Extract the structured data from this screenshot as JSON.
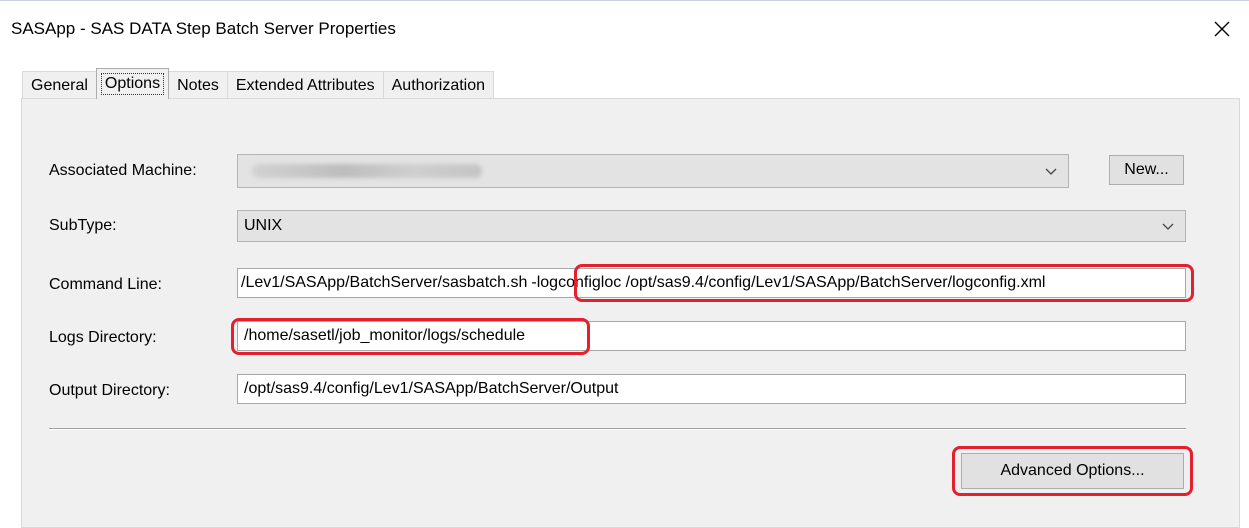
{
  "window": {
    "title": "SASApp - SAS DATA Step Batch Server Properties"
  },
  "tabs": [
    {
      "label": "General",
      "active": false
    },
    {
      "label": "Options",
      "active": true
    },
    {
      "label": "Notes",
      "active": false
    },
    {
      "label": "Extended Attributes",
      "active": false
    },
    {
      "label": "Authorization",
      "active": false
    }
  ],
  "form": {
    "associated_machine": {
      "label": "Associated Machine:",
      "value": ""
    },
    "new_button": "New...",
    "subtype": {
      "label": "SubType:",
      "value": "UNIX"
    },
    "command_line": {
      "label": "Command Line:",
      "value_part1": "/Lev1/SASApp/BatchServer/sasbatch.sh",
      "value_part2": "-logconfigloc /opt/sas9.4/config/Lev1/SASApp/BatchServer/logconfig.xml"
    },
    "logs_directory": {
      "label": "Logs Directory:",
      "value": "/home/sasetl/job_monitor/logs/schedule"
    },
    "output_directory": {
      "label": "Output Directory:",
      "value": "/opt/sas9.4/config/Lev1/SASApp/BatchServer/Output"
    },
    "advanced_button": "Advanced Options..."
  },
  "colors": {
    "highlight": "#e3202e",
    "panel_bg": "#f0f0f0"
  },
  "icons": {
    "close": "close-icon",
    "dropdown": "chevron-down-icon"
  }
}
